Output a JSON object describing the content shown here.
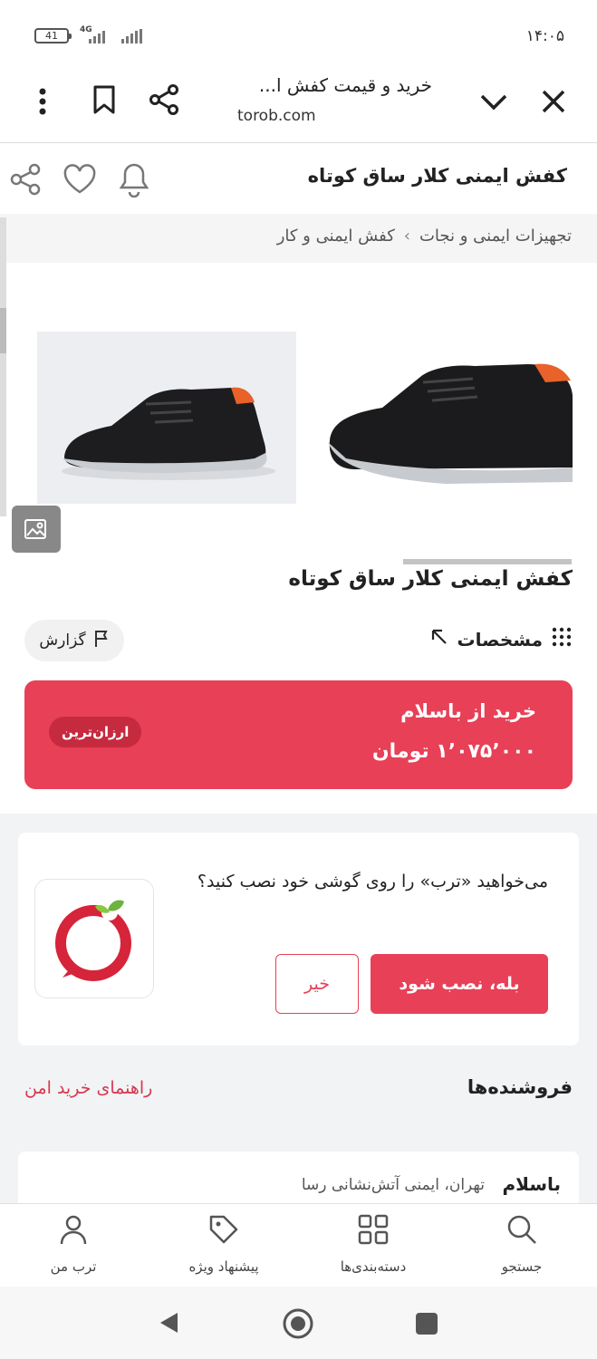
{
  "status_bar": {
    "battery": "41",
    "network": "4G",
    "time": "۱۴:۰۵"
  },
  "browser": {
    "page_title": "خرید و قیمت کفش ا...",
    "host": "torob.com"
  },
  "product_header": {
    "title": "کفش ایمنی کلار ساق کوتاه"
  },
  "breadcrumb": {
    "items": [
      "تجهیزات ایمنی و نجات",
      "کفش ایمنی و کار"
    ],
    "separator": "›"
  },
  "product": {
    "title": "کفش ایمنی کلار ساق کوتاه",
    "specs_label": "مشخصات",
    "report_label": "گزارش"
  },
  "buy_box": {
    "line1": "خرید از باسلام",
    "price": "۱٬۰۷۵٬۰۰۰ تومان",
    "badge": "ارزان‌ترین",
    "color": "#e84057"
  },
  "install_prompt": {
    "text": "می‌خواهید «ترب» را روی گوشی خود نصب کنید؟",
    "yes_label": "بله، نصب شود",
    "no_label": "خیر"
  },
  "sellers": {
    "title": "فروشنده‌ها",
    "safe_buy_link": "راهنمای خرید امن",
    "first": {
      "name": "باسلام",
      "location": "تهران، ایمنی آتش‌نشانی رسا"
    }
  },
  "bottom_nav": {
    "items": [
      {
        "label": "جستجو",
        "icon": "search-icon"
      },
      {
        "label": "دسته‌بندی‌ها",
        "icon": "grid-icon"
      },
      {
        "label": "پیشنهاد ویژه",
        "icon": "tag-icon"
      },
      {
        "label": "ترب من",
        "icon": "user-icon"
      }
    ]
  }
}
